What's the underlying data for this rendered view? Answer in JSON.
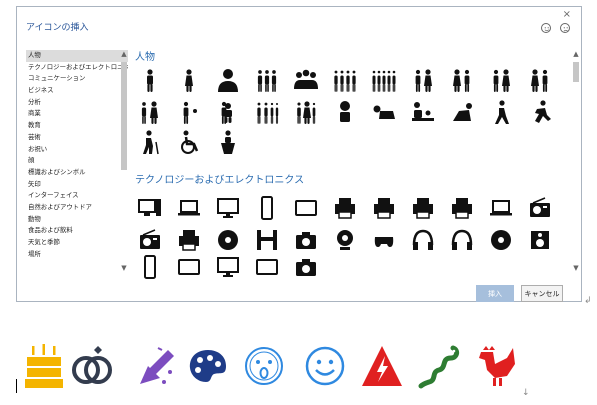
{
  "dialog": {
    "title": "アイコンの挿入",
    "close_glyph": "×",
    "feedback_happy": "smiley-icon",
    "feedback_sad": "frown-icon",
    "categories": [
      "人物",
      "テクノロジーおよびエレクトロニクス",
      "コミュニケーション",
      "ビジネス",
      "分析",
      "商業",
      "教育",
      "芸術",
      "お祝い",
      "顔",
      "標識およびシンボル",
      "矢印",
      "インターフェイス",
      "自然およびアウトドア",
      "動物",
      "食品および飲料",
      "天気と季節",
      "場所"
    ],
    "selected_category": "人物",
    "sections": [
      {
        "title": "人物"
      },
      {
        "title": "テクノロジーおよびエレクトロニクス"
      }
    ],
    "buttons": {
      "insert": "挿入",
      "cancel": "キャンセル"
    }
  },
  "document": {
    "paragraph_mark": "↲",
    "line_end_mark": "↓",
    "inserted_icons": [
      "cake-icon",
      "rings-icon",
      "party-popper-icon",
      "palette-icon",
      "surprised-face-icon",
      "smiley-icon",
      "high-voltage-icon",
      "snake-icon",
      "rooster-icon"
    ],
    "colors": {
      "yellow": "#f4b400",
      "dark": "#333c4e",
      "purple": "#7c4dbf",
      "navy": "#1f3c88",
      "blue": "#2f89e0",
      "red": "#e02020",
      "green": "#2e7d32"
    }
  }
}
